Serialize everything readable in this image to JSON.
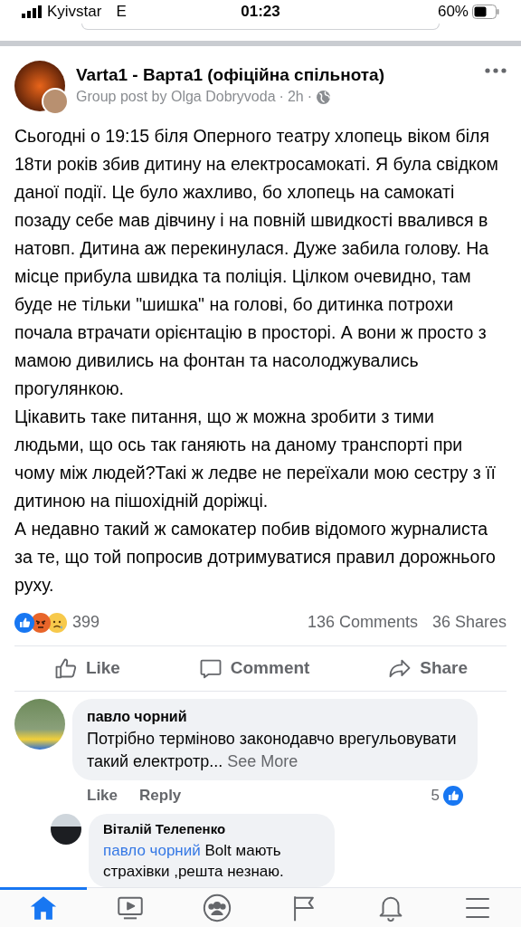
{
  "status_bar": {
    "carrier": "Kyivstar",
    "network": "E",
    "time": "01:23",
    "battery": "60%"
  },
  "post": {
    "group": "Varta1 - Варта1 (офіційна спільнота)",
    "byline": "Group post by Olga Dobryvoda",
    "time": "2h",
    "separator": "·",
    "paragraphs": [
      "Сьогодні о 19:15 біля Оперного театру хлопець віком біля 18ти років збив дитину на електросамокаті. Я була свідком даної події. Це було жахливо, бо хлопець на самокаті позаду себе мав дівчину і на повній швидкості ввалився в натовп. Дитина аж перекинулася. Дуже забила голову. На місце прибула швидка та поліція. Цілком очевидно, там буде не тільки \"шишка\" на голові, бо дитинка потрохи почала втрачати орієнтацію в просторі. А вони  ж просто з мамою дивились на фонтан та насолоджувались прогулянкою.",
      "Цікавить таке питання, що ж можна зробити з тими людьми, що ось так ганяють на даному транспорті при чому між людей?Такі ж ледве не переїхали мою сестру з її дитиною на пішохідній доріжці.",
      "А недавно такий  ж самокатер побив відомого журналиста за те, що той попросив дотримуватися правил дорожнього руху."
    ],
    "reactions": [
      {
        "kind": "like"
      },
      {
        "kind": "angry"
      },
      {
        "kind": "sad"
      }
    ],
    "reaction_count": "399",
    "comments": "136 Comments",
    "shares": "36 Shares",
    "actions": [
      {
        "kind": "like",
        "label": "Like"
      },
      {
        "kind": "comment",
        "label": "Comment"
      },
      {
        "kind": "share",
        "label": "Share"
      }
    ]
  },
  "comment": {
    "author": "павло чорний",
    "text": "Потрібно  терміново  законодавчо врегульовувати такий  електротр...",
    "see_more": "See More",
    "like": "Like",
    "reply": "Reply",
    "like_count": "5",
    "reply_comment": {
      "author": "Віталій Телепенко",
      "mention": "павло чорний",
      "text": "Bolt мають страхівки ,решта незнаю."
    }
  },
  "nav": [
    {
      "kind": "home",
      "selected": true
    },
    {
      "kind": "video",
      "selected": false
    },
    {
      "kind": "groups",
      "selected": false
    },
    {
      "kind": "pages",
      "selected": false
    },
    {
      "kind": "notifications",
      "selected": false
    },
    {
      "kind": "menu",
      "selected": false
    }
  ]
}
